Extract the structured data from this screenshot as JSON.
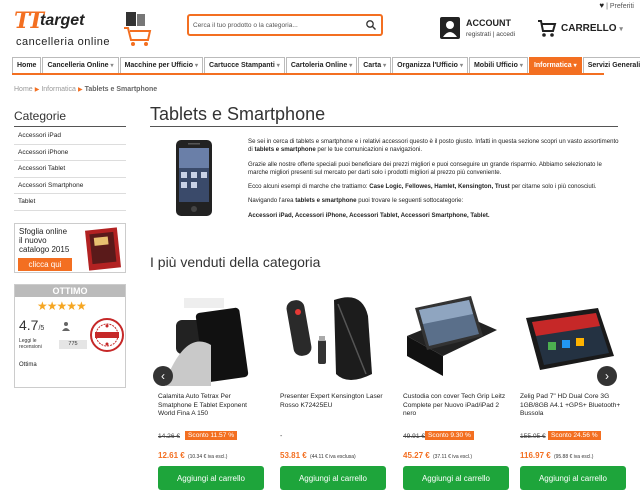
{
  "topbar": {
    "favorites_label": "| Preferiti"
  },
  "brand": {
    "logo_t": "TT",
    "logo_name": "target",
    "logo_sub": "cancelleria online"
  },
  "search": {
    "placeholder": "Cerca il tuo prodotto o la categoria..."
  },
  "account": {
    "title": "ACCOUNT",
    "subtitle": "registrati | accedi"
  },
  "cart": {
    "label": "CARRELLO"
  },
  "nav": [
    {
      "label": "Home",
      "dropdown": false,
      "active": false
    },
    {
      "label": "Cancelleria Online",
      "dropdown": true,
      "active": false
    },
    {
      "label": "Macchine per Ufficio",
      "dropdown": true,
      "active": false
    },
    {
      "label": "Cartucce Stampanti",
      "dropdown": true,
      "active": false
    },
    {
      "label": "Cartoleria Online",
      "dropdown": true,
      "active": false
    },
    {
      "label": "Carta",
      "dropdown": true,
      "active": false
    },
    {
      "label": "Organizza l'Ufficio",
      "dropdown": true,
      "active": false
    },
    {
      "label": "Mobili Ufficio",
      "dropdown": true,
      "active": false
    },
    {
      "label": "Informatica",
      "dropdown": true,
      "active": true
    },
    {
      "label": "Servizi Generali",
      "dropdown": true,
      "active": false
    }
  ],
  "breadcrumb": {
    "home": "Home",
    "parent": "Informatica",
    "current": "Tablets e Smartphone"
  },
  "sidebar": {
    "title": "Categorie",
    "items": [
      {
        "label": "Accessori iPad"
      },
      {
        "label": "Accessori iPhone"
      },
      {
        "label": "Accessori Tablet"
      },
      {
        "label": "Accessori Smartphone"
      },
      {
        "label": "Tablet"
      }
    ]
  },
  "catalog": {
    "line1": "Sfoglia online",
    "line2": "il nuovo",
    "line3": "catalogo 2015",
    "button": "clicca qui"
  },
  "rating": {
    "header": "OTTIMO",
    "stars": "★★★★★",
    "score": "4.7",
    "score_suffix": "/5",
    "reviews_label_1": "Leggi le",
    "reviews_label_2": "recensioni",
    "reviews_count": "775",
    "footer": "Ottima"
  },
  "main": {
    "title": "Tablets e Smartphone",
    "p1_a": "Se sei in cerca di tablets e smartphone e i relativi accessori questo è il posto giusto. Infatti in questa sezione scopri un vasto assortimento di ",
    "p1_b": "tablets e smartphone",
    "p1_c": " per le tue comunicazioni e navigazioni.",
    "p2": "Grazie alle nostre offerte speciali puoi beneficiare dei prezzi migliori e puoi conseguire un grande risparmio. Abbiamo selezionato le marche migliori presenti sul mercato per darti solo i prodotti migliori al prezzo più conveniente.",
    "p3_a": "Ecco alcuni esempi di marche che trattiamo: ",
    "p3_b": "Case Logic, Fellowes, Hamlet, Kensington, Trust",
    "p3_c": " per citarne solo i più conosciuti.",
    "p4_a": "Navigando l'area ",
    "p4_b": "tablets e smartphone",
    "p4_c": " puoi trovare le seguenti sottocategorie:",
    "p5": "Accessori iPad, Accessori iPhone, Accessori Tablet, Accessori Smartphone, Tablet."
  },
  "bestsellers": {
    "title": "I più venduti della categoria",
    "products": [
      {
        "name": "Calamita Auto Tetrax Per Smatphone E Tablet Exponent World Fina A 150",
        "old_price": "14.26 €",
        "discount": "Sconto 11.57 %",
        "price": "12.61 €",
        "iva": "(10.34 € iva escl.)",
        "button": "Aggiungi al carrello"
      },
      {
        "name": "Presenter Expert Kensington Laser Rosso K72425EU",
        "old_price": "",
        "dash": "-",
        "discount": "",
        "price": "53.81 €",
        "iva": "(44.11 € iva esclusa)",
        "button": "Aggiungi al carrello"
      },
      {
        "name": "Custodia con cover Tech Grip Leitz Complete per Nuovo iPad/iPad 2 nero",
        "old_price": "49.91 €",
        "discount": "Sconto 9.30 %",
        "price": "45.27 €",
        "iva": "(37.11 € iva escl.)",
        "button": "Aggiungi al carrello"
      },
      {
        "name": "Zelig Pad 7\" HD Dual Core 3G 1GB/8GB A4.1 +GPS+ Bluetooth+ Bussola",
        "old_price": "155.05 €",
        "discount": "Sconto 24.56 %",
        "price": "116.97 €",
        "iva": "(95.88 € iva escl.)",
        "button": "Aggiungi al carrello"
      }
    ]
  },
  "colors": {
    "accent": "#f36f21",
    "add_button": "#1ea53b",
    "star": "#f5a623"
  },
  "icons": {
    "prev": "chevron-left-icon",
    "next": "chevron-right-icon"
  }
}
